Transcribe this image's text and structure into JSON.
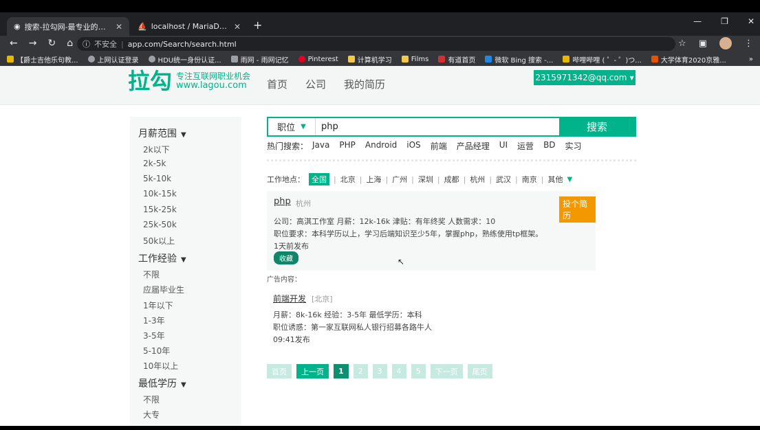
{
  "browser": {
    "tabs": [
      {
        "title": "搜索-拉勾网-最专业的互联网招聘",
        "active": true
      },
      {
        "title": "localhost / MariaDB / recruit /",
        "active": false
      }
    ],
    "address": {
      "insecure_label": "不安全",
      "url": "app.com/Search/search.html"
    },
    "bookmarks": [
      "【爵士吉他乐句教...",
      "上网认证登录",
      "HDU统一身份认证...",
      "雨网 - 雨网记忆",
      "Pinterest",
      "计算机学习",
      "Films",
      "有道首页",
      "微软 Bing 搜索 -...",
      "哔哩哔哩 ( ゜- ゜)つ...",
      "大学体育2020京雅..."
    ]
  },
  "header": {
    "logo_main": "拉勾",
    "logo_tagline": "专注互联网职业机会",
    "logo_url": "www.lagou.com",
    "nav": [
      "首页",
      "公司",
      "我的简历"
    ],
    "user": "2315971342@qq.com"
  },
  "sidebar": {
    "salary": {
      "title": "月薪范围",
      "options": [
        "2k以下",
        "2k-5k",
        "5k-10k",
        "10k-15k",
        "15k-25k",
        "25k-50k",
        "50k以上"
      ]
    },
    "experience": {
      "title": "工作经验",
      "options": [
        "不限",
        "应届毕业生",
        "1年以下",
        "1-3年",
        "3-5年",
        "5-10年",
        "10年以上"
      ]
    },
    "education": {
      "title": "最低学历",
      "options": [
        "不限",
        "大专"
      ]
    }
  },
  "search": {
    "category": "职位",
    "query": "php",
    "button": "搜索",
    "hot_label": "热门搜索：",
    "hot": [
      "Java",
      "PHP",
      "Android",
      "iOS",
      "前端",
      "产品经理",
      "UI",
      "运营",
      "BD",
      "实习"
    ]
  },
  "location": {
    "label": "工作地点：",
    "all": "全国",
    "cities": [
      "北京",
      "上海",
      "广州",
      "深圳",
      "成都",
      "杭州",
      "武汉",
      "南京"
    ],
    "more": "其他"
  },
  "jobs": [
    {
      "title": "php",
      "city": "杭州",
      "apply": "投个简历",
      "meta": "公司：高淇工作室   月薪：12k-16k   津贴：有年终奖   人数需求：10",
      "req": "职位要求：本科学历以上，学习后端知识至少5年，掌握php，熟练使用tp框架。",
      "time": "1天前发布",
      "fav": "收藏"
    }
  ],
  "ad": {
    "label": "广告内容：",
    "title": "前端开发",
    "city": "[北京]",
    "meta": "月薪：8k-16k   经验：3-5年   最低学历：本科",
    "lure": "职位诱惑：第一家互联网私人银行招募各路牛人",
    "time": "09:41发布"
  },
  "pagination": {
    "first": "首页",
    "prev": "上一页",
    "pages": [
      "1",
      "2",
      "3",
      "4",
      "5"
    ],
    "next": "下一页",
    "last": "尾页"
  },
  "colors": {
    "brand": "#00b38a",
    "apply": "#f39800"
  }
}
